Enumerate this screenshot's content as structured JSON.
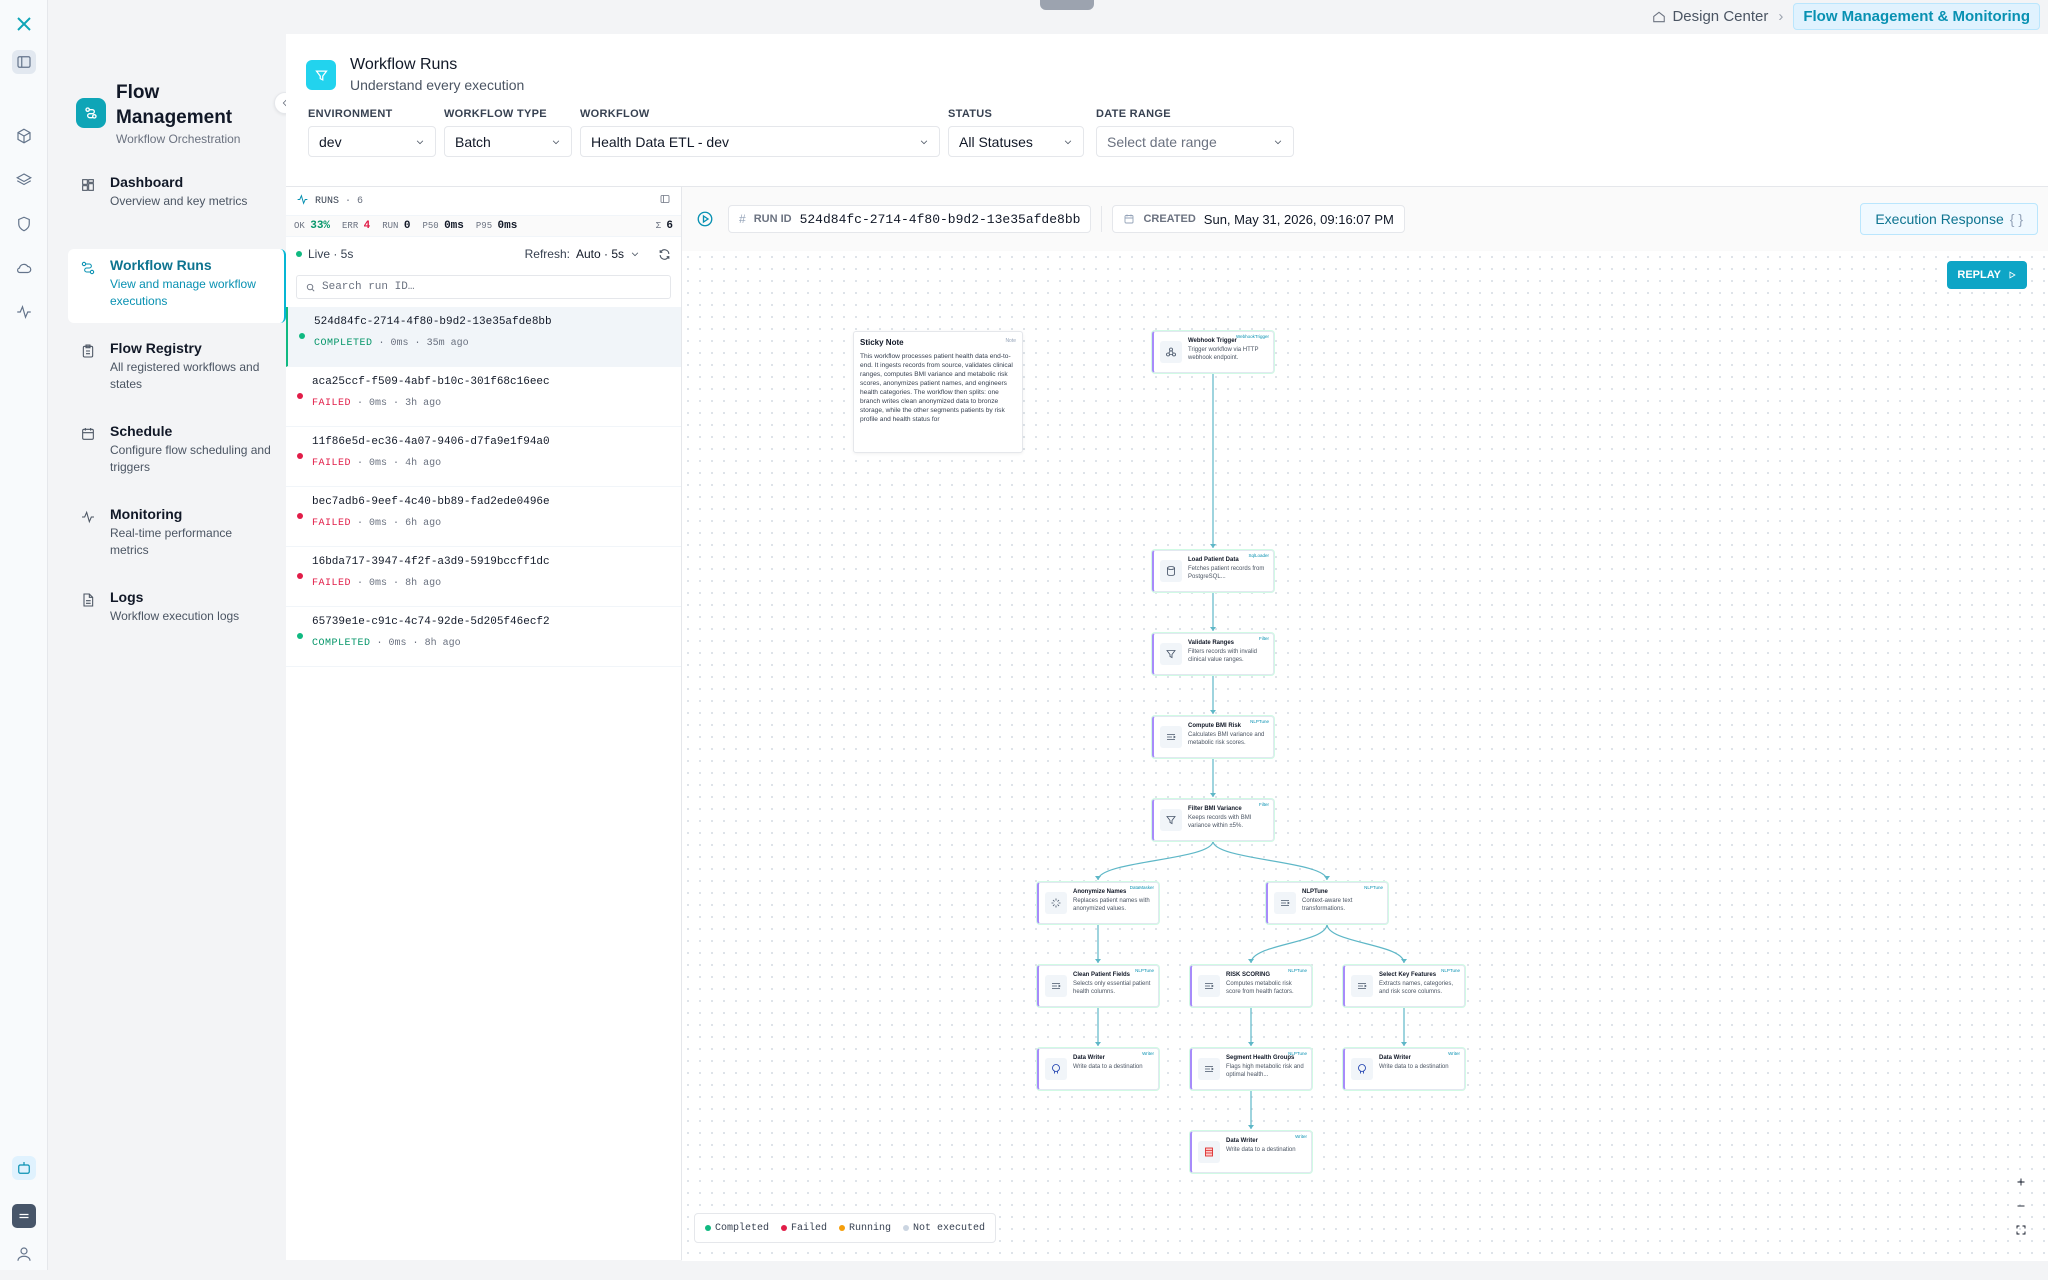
{
  "breadcrumb": {
    "home": "Design Center",
    "current": "Flow Management & Monitoring"
  },
  "sidebar": {
    "title": "Flow Management",
    "subtitle": "Workflow Orchestration",
    "items": [
      {
        "label": "Dashboard",
        "desc": "Overview and key metrics",
        "icon": "grid-icon"
      },
      {
        "label": "Workflow Runs",
        "desc": "View and manage workflow executions",
        "icon": "flow-icon"
      },
      {
        "label": "Flow Registry",
        "desc": "All registered workflows and states",
        "icon": "clipboard-icon"
      },
      {
        "label": "Schedule",
        "desc": "Configure flow scheduling and triggers",
        "icon": "calendar-icon"
      },
      {
        "label": "Monitoring",
        "desc": "Real-time performance metrics",
        "icon": "pulse-icon"
      },
      {
        "label": "Logs",
        "desc": "Workflow execution logs",
        "icon": "document-icon"
      }
    ]
  },
  "header": {
    "title": "Workflow Runs",
    "subtitle": "Understand every execution"
  },
  "filters": {
    "environment": {
      "label": "ENVIRONMENT",
      "value": "dev"
    },
    "workflow_type": {
      "label": "WORKFLOW TYPE",
      "value": "Batch"
    },
    "workflow": {
      "label": "WORKFLOW",
      "value": "Health Data ETL - dev"
    },
    "status": {
      "label": "STATUS",
      "value": "All Statuses"
    },
    "date_range": {
      "label": "DATE RANGE",
      "placeholder": "Select date range"
    }
  },
  "runs_panel": {
    "title": "RUNS",
    "count": "· 6",
    "stats": {
      "ok_label": "OK",
      "ok": "33%",
      "err_label": "ERR",
      "err": "4",
      "run_label": "RUN",
      "run": "0",
      "p50_label": "P50",
      "p50": "0ms",
      "p95_label": "P95",
      "p95": "0ms",
      "total_label": "Σ",
      "total": "6"
    },
    "live": "Live · 5s",
    "refresh_label": "Refresh:",
    "refresh_value": "Auto · 5s",
    "search_placeholder": "Search run ID…",
    "runs": [
      {
        "id": "524d84fc-2714-4f80-b9d2-13e35afde8bb",
        "status": "COMPLETED",
        "duration": "0ms",
        "age": "35m ago"
      },
      {
        "id": "aca25ccf-f509-4abf-b10c-301f68c16eec",
        "status": "FAILED",
        "duration": "0ms",
        "age": "3h ago"
      },
      {
        "id": "11f86e5d-ec36-4a07-9406-d7fa9e1f94a0",
        "status": "FAILED",
        "duration": "0ms",
        "age": "4h ago"
      },
      {
        "id": "bec7adb6-9eef-4c40-bb89-fad2ede0496e",
        "status": "FAILED",
        "duration": "0ms",
        "age": "6h ago"
      },
      {
        "id": "16bda717-3947-4f2f-a3d9-5919bccff1dc",
        "status": "FAILED",
        "duration": "0ms",
        "age": "8h ago"
      },
      {
        "id": "65739e1e-c91c-4c74-92de-5d205f46ecf2",
        "status": "COMPLETED",
        "duration": "0ms",
        "age": "8h ago"
      }
    ]
  },
  "detail": {
    "run_id_label": "RUN ID",
    "run_id": "524d84fc-2714-4f80-b9d2-13e35afde8bb",
    "created_label": "CREATED",
    "created": "Sun, May 31, 2026, 09:16:07 PM",
    "exec_label": "Execution Response",
    "exec_glyph": "{ }",
    "replay_label": "REPLAY"
  },
  "sticky_note": {
    "title": "Sticky Note",
    "tag": "Note",
    "body": "This workflow processes patient health data end-to-end. It ingests records from source, validates clinical ranges, computes BMI variance and metabolic risk scores, anonymizes patient names, and engineers health categories. The workflow then splits: one branch writes clean anonymized data to bronze storage, while the other segments patients by risk profile and health status for"
  },
  "nodes": [
    {
      "key": "webhook",
      "title": "Webhook Trigger",
      "desc": "Trigger workflow via HTTP webhook endpoint.",
      "tag": "WebhookTrigger",
      "icon": "webhook-icon"
    },
    {
      "key": "load",
      "title": "Load Patient Data",
      "desc": "Fetches patient records from PostgreSQL...",
      "tag": "SqlLoader",
      "icon": "database-icon"
    },
    {
      "key": "validate",
      "title": "Validate Ranges",
      "desc": "Filters records with invalid clinical value ranges.",
      "tag": "Filter",
      "icon": "filter-icon"
    },
    {
      "key": "bmi",
      "title": "Compute BMI Risk",
      "desc": "Calculates BMI variance and metabolic risk scores.",
      "tag": "NLPTune",
      "icon": "transform-icon"
    },
    {
      "key": "filterbmi",
      "title": "Filter BMI Variance",
      "desc": "Keeps records with BMI variance within ±5%.",
      "tag": "Filter",
      "icon": "filter-icon"
    },
    {
      "key": "anon",
      "title": "Anonymize Names",
      "desc": "Replaces patient names with anonymized values.",
      "tag": "DataMasker",
      "icon": "mask-icon"
    },
    {
      "key": "nlp",
      "title": "NLPTune",
      "desc": "Context-aware text transformations.",
      "tag": "NLPTune",
      "icon": "transform-icon"
    },
    {
      "key": "clean",
      "title": "Clean Patient Fields",
      "desc": "Selects only essential patient health columns.",
      "tag": "NLPTune",
      "icon": "transform-icon"
    },
    {
      "key": "risk",
      "title": "RISK SCORING",
      "desc": "Computes metabolic risk score from health factors.",
      "tag": "NLPTune",
      "icon": "transform-icon"
    },
    {
      "key": "select",
      "title": "Select Key Features",
      "desc": "Extracts names, categories, and risk score columns.",
      "tag": "NLPTune",
      "icon": "transform-icon"
    },
    {
      "key": "writer1",
      "title": "Data Writer",
      "desc": "Write data to a destination",
      "tag": "Writer",
      "icon": "postgres-icon"
    },
    {
      "key": "segment",
      "title": "Segment Health Groups",
      "desc": "Flags high metabolic risk and optimal health...",
      "tag": "NLPTune",
      "icon": "transform-icon"
    },
    {
      "key": "writer2",
      "title": "Data Writer",
      "desc": "Write data to a destination",
      "tag": "Writer",
      "icon": "postgres-icon"
    },
    {
      "key": "writer3",
      "title": "Data Writer",
      "desc": "Write data to a destination",
      "tag": "Writer",
      "icon": "storage-icon"
    }
  ],
  "legend": [
    {
      "label": "Completed",
      "color": "#10b981"
    },
    {
      "label": "Failed",
      "color": "#e11d48"
    },
    {
      "label": "Running",
      "color": "#f59e0b"
    },
    {
      "label": "Not executed",
      "color": "#cbd5e1"
    }
  ],
  "colors": {
    "accent": "#0ea5b7",
    "completed": "#10b981",
    "failed": "#e11d48"
  }
}
